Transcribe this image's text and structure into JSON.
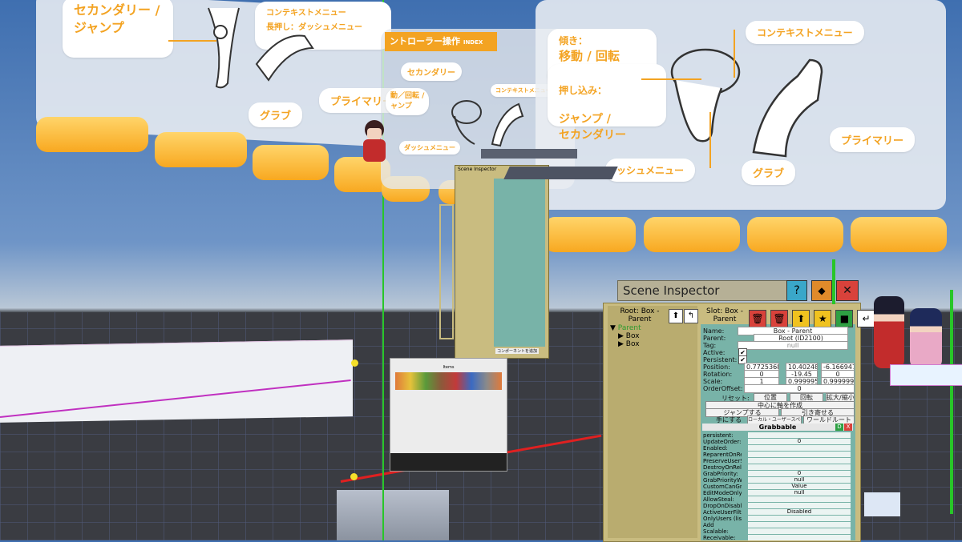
{
  "scene": {
    "left_board": {
      "labels": [
        "セカンダリー /\nジャンプ",
        "コンテキストメニュー\n長押し：ダッシュメニュー",
        "プライマリー",
        "グラブ"
      ]
    },
    "mid_board": {
      "title": "ントローラー操作",
      "title_tag": "INDEX",
      "labels": [
        "セカンダリー",
        "コンテキストメニュー",
        "動／回転 /\nャンプ",
        "ダッシュメニュー"
      ]
    },
    "right_board": {
      "tilt_label": "傾き：",
      "tilt_action": "移動 / 回転",
      "press_label": "押し込み：",
      "press_action": "ジャンプ /\nセカンダリー",
      "context_label": "コンテキストメニュー",
      "primary_label": "プライマリー",
      "grab_label": "グラブ",
      "dash_label": "ッシュメニュー"
    },
    "small_inspector_title": "Scene Inspector",
    "small_inspector_footer": "コンポーネントを追加",
    "hotbar_title": "Items"
  },
  "inspector": {
    "title": "Scene Inspector",
    "title_buttons": [
      "?",
      "◆",
      "✕"
    ],
    "root_label": "Root: Box - Parent",
    "slot_label": "Slot: Box - Parent",
    "tree": {
      "root": "Parent",
      "children": [
        "Box",
        "Box"
      ]
    },
    "fields": {
      "name": {
        "label": "Name:",
        "value": "Box - Parent"
      },
      "parent": {
        "label": "Parent:",
        "value": "Root (ID2100)"
      },
      "tag": {
        "label": "Tag:",
        "value": "null"
      },
      "active": {
        "label": "Active:"
      },
      "persistent": {
        "label": "Persistent:"
      },
      "position": {
        "label": "Position:",
        "x": "0.7725368",
        "y": "10.40248",
        "z": "-6.166947"
      },
      "rotation": {
        "label": "Rotation:",
        "x": "0",
        "y": "-19.45",
        "z": "0"
      },
      "scale": {
        "label": "Scale:",
        "x": "1",
        "y": "0.999995",
        "z": "0.9999994"
      },
      "order_offset": {
        "label": "OrderOffset:",
        "value": "0"
      }
    },
    "reset_label": "リセット:",
    "reset_buttons": [
      "位置",
      "回転",
      "拡大/縮小"
    ],
    "center_button": "中心に軸を作成",
    "jump_button": "ジャンプする",
    "pull_button": "引き寄せる",
    "space_label": "手にする",
    "space_local": "ローカル・ユーザースペース",
    "space_world": "ワールドルート",
    "component": {
      "name": "Grabbable",
      "rows": [
        {
          "label": "persistent:",
          "value": ""
        },
        {
          "label": "UpdateOrder:",
          "value": "0"
        },
        {
          "label": "Enabled:",
          "value": ""
        },
        {
          "label": "ReparentOnRelease:",
          "value": ""
        },
        {
          "label": "PreserveUserSpace:",
          "value": ""
        },
        {
          "label": "DestroyOnRelease:",
          "value": ""
        },
        {
          "label": "GrabPriority:",
          "value": "0"
        },
        {
          "label": "GrabPriorityWhenGrabbed:",
          "value": "null"
        },
        {
          "label": "CustomCanGrabCheck:",
          "value": "Value"
        },
        {
          "label": "EditModeOnly:",
          "value": "null"
        },
        {
          "label": "AllowSteal:",
          "value": ""
        },
        {
          "label": "DropOnDisable:",
          "value": ""
        },
        {
          "label": "ActiveUserFilter:",
          "value": "Disabled"
        },
        {
          "label": "OnlyUsers (list):",
          "value": ""
        },
        {
          "label": "Add",
          "value": ""
        },
        {
          "label": "Scalable:",
          "value": ""
        },
        {
          "label": "Receivable:",
          "value": ""
        }
      ]
    }
  },
  "colors": {
    "orange": "#f3a322",
    "inspector_bg": "#c9bc80",
    "teal": "#78b3a8",
    "red_button": "#d9423b",
    "yellow_button": "#f0c21f",
    "green_button": "#2ea043"
  }
}
